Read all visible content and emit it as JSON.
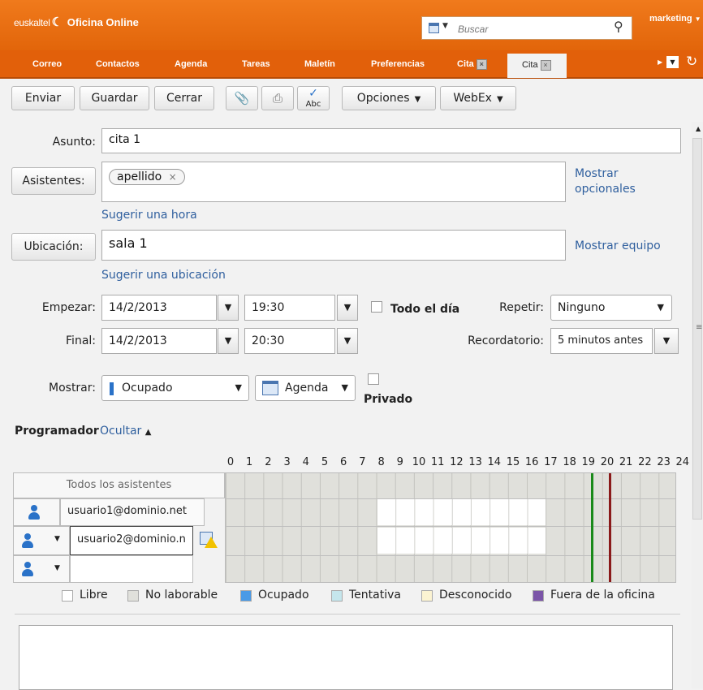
{
  "header": {
    "brand": "euskaltel",
    "app_title": "Oficina Online",
    "search_placeholder": "Buscar",
    "user": "marketing"
  },
  "nav": {
    "items": [
      "Correo",
      "Contactos",
      "Agenda",
      "Tareas",
      "Maletín",
      "Preferencias",
      "Cita"
    ],
    "active_tab": "Cita",
    "close_glyph": "×"
  },
  "toolbar": {
    "send": "Enviar",
    "save": "Guardar",
    "close": "Cerrar",
    "options": "Opciones",
    "webex": "WebEx",
    "spell_label": "Abc"
  },
  "form": {
    "subject_label": "Asunto:",
    "subject_value": "cita 1",
    "attendees_button": "Asistentes:",
    "attendee_chip": "apellido",
    "show_optional": "Mostrar opcionales",
    "suggest_time": "Sugerir una hora",
    "location_button": "Ubicación:",
    "location_value": "sala 1",
    "show_equipment": "Mostrar equipo",
    "suggest_location": "Sugerir una ubicación",
    "start_label": "Empezar:",
    "start_date": "14/2/2013",
    "start_time": "19:30",
    "all_day": "Todo el día",
    "repeat_label": "Repetir:",
    "repeat_value": "Ninguno",
    "end_label": "Final:",
    "end_date": "14/2/2013",
    "end_time": "20:30",
    "reminder_label": "Recordatorio:",
    "reminder_value": "5 minutos antes",
    "show_label": "Mostrar:",
    "show_value": "Ocupado",
    "calendar_value": "Agenda",
    "private_label": "Privado"
  },
  "scheduler": {
    "title": "Programador",
    "hide_link": "Ocultar",
    "hours": [
      "0",
      "1",
      "2",
      "3",
      "4",
      "5",
      "6",
      "7",
      "8",
      "9",
      "10",
      "11",
      "12",
      "13",
      "14",
      "15",
      "16",
      "17",
      "18",
      "19",
      "20",
      "21",
      "22",
      "23",
      "24"
    ],
    "all_attendees": "Todos los asistentes",
    "user1": "usuario1@dominio.net",
    "user2": "usuario2@dominio.n",
    "start_marker_color": "#1a8a1a",
    "end_marker_color": "#8a1a1a"
  },
  "legend": [
    {
      "label": "Libre",
      "color": "#ffffff"
    },
    {
      "label": "No laborable",
      "color": "#e0e0db"
    },
    {
      "label": "Ocupado",
      "color": "#4a9ae6"
    },
    {
      "label": "Tentativa",
      "color": "#c5e6ec"
    },
    {
      "label": "Desconocido",
      "color": "#fbf3d2"
    },
    {
      "label": "Fuera de la oficina",
      "color": "#7b55a8"
    }
  ]
}
